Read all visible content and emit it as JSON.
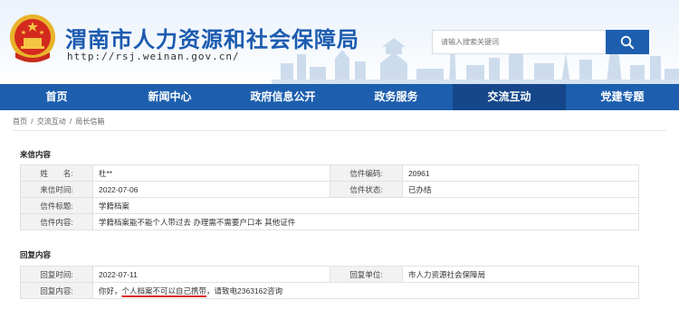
{
  "header": {
    "title": "渭南市人力资源和社会保障局",
    "url": "http://rsj.weinan.gov.cn/",
    "search_placeholder": "请输入搜索关键词",
    "search_icon": "search-icon"
  },
  "nav": {
    "items": [
      "首页",
      "新闻中心",
      "政府信息公开",
      "政务服务",
      "交流互动",
      "党建专题"
    ],
    "active_index": 4
  },
  "breadcrumb": [
    "首页",
    "/",
    "交流互动",
    "/",
    "局长信箱"
  ],
  "letter": {
    "section_title": "来信内容",
    "name_label": "姓　　名:",
    "name_value": "杜**",
    "code_label": "信件编码:",
    "code_value": "20961",
    "time_label": "来信时间:",
    "time_value": "2022-07-06",
    "status_label": "信件状态:",
    "status_value": "已办结",
    "subject_label": "信件标题:",
    "subject_value": "学籍档案",
    "content_label": "信件内容:",
    "content_value": "学籍档案能不能个人带过去 办理需不需要户口本 其他证件"
  },
  "reply": {
    "section_title": "回复内容",
    "time_label": "回复时间:",
    "time_value": "2022-07-11",
    "unit_label": "回复单位:",
    "unit_value": "市人力资源社会保障局",
    "content_label": "回复内容:",
    "content_prefix": "你好，",
    "content_highlight": "个人档案不可以自己携带",
    "content_suffix": "，请致电2363162咨询"
  },
  "colors": {
    "brand_blue": "#1d5fae",
    "nav_active": "#15478a",
    "title_blue": "#1c5bb0",
    "annotation_red": "#d22222"
  }
}
